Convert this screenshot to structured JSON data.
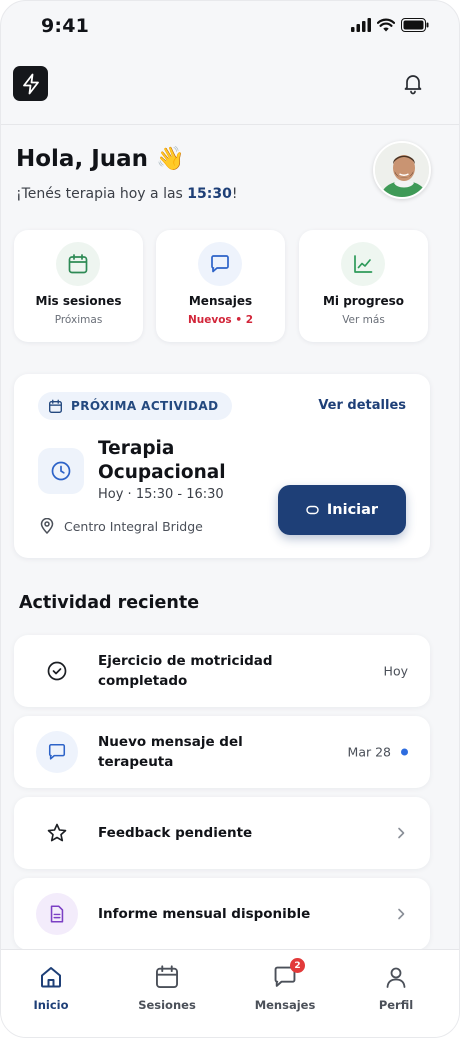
{
  "status_bar": {
    "time": "9:41"
  },
  "greeting": {
    "title": "Hola, Juan",
    "emoji": "👋",
    "subtitle_prefix": "¡Tenés terapia hoy a las ",
    "subtitle_time": "15:30",
    "subtitle_suffix": "!"
  },
  "quick_cards": [
    {
      "label": "Mis sesiones",
      "sub": "Próximas",
      "icon": "calendar-icon"
    },
    {
      "label": "Mensajes",
      "sub": "Nuevos • 2",
      "icon": "message-icon"
    },
    {
      "label": "Mi progreso",
      "sub": "Ver más",
      "icon": "chart-icon"
    }
  ],
  "next_activity": {
    "badge": "PRÓXIMA ACTIVIDAD",
    "details_link": "Ver detalles",
    "title": "Terapia Ocupacional",
    "time": "Hoy · 15:30 - 16:30",
    "location": "Centro Integral Bridge",
    "start_button": "Iniciar"
  },
  "recent_title": "Actividad reciente",
  "recent": [
    {
      "text": "Ejercicio de motricidad completado",
      "meta": "Hoy",
      "icon": "check-circle-icon"
    },
    {
      "text": "Nuevo mensaje del terapeuta",
      "meta": "Mar 28",
      "icon": "message-icon",
      "unread": true
    },
    {
      "text": "Feedback pendiente",
      "icon": "star-icon",
      "chevron": true
    },
    {
      "text": "Informe mensual disponible",
      "icon": "document-icon",
      "chevron": true
    }
  ],
  "bottom_nav": [
    {
      "label": "Inicio",
      "icon": "home-icon",
      "active": true
    },
    {
      "label": "Sesiones",
      "icon": "calendar-icon"
    },
    {
      "label": "Mensajes",
      "icon": "message-icon",
      "badge": "2"
    },
    {
      "label": "Perfil",
      "icon": "user-icon"
    }
  ],
  "colors": {
    "primary": "#1e3f77",
    "background": "#f6f7f9",
    "card": "#ffffff",
    "sessions_icon": "#2e8a55",
    "messages_icon": "#2d63c8",
    "progress_icon": "#2e9a5a",
    "alert": "#d2263a",
    "document_icon": "#7b3fc4"
  }
}
